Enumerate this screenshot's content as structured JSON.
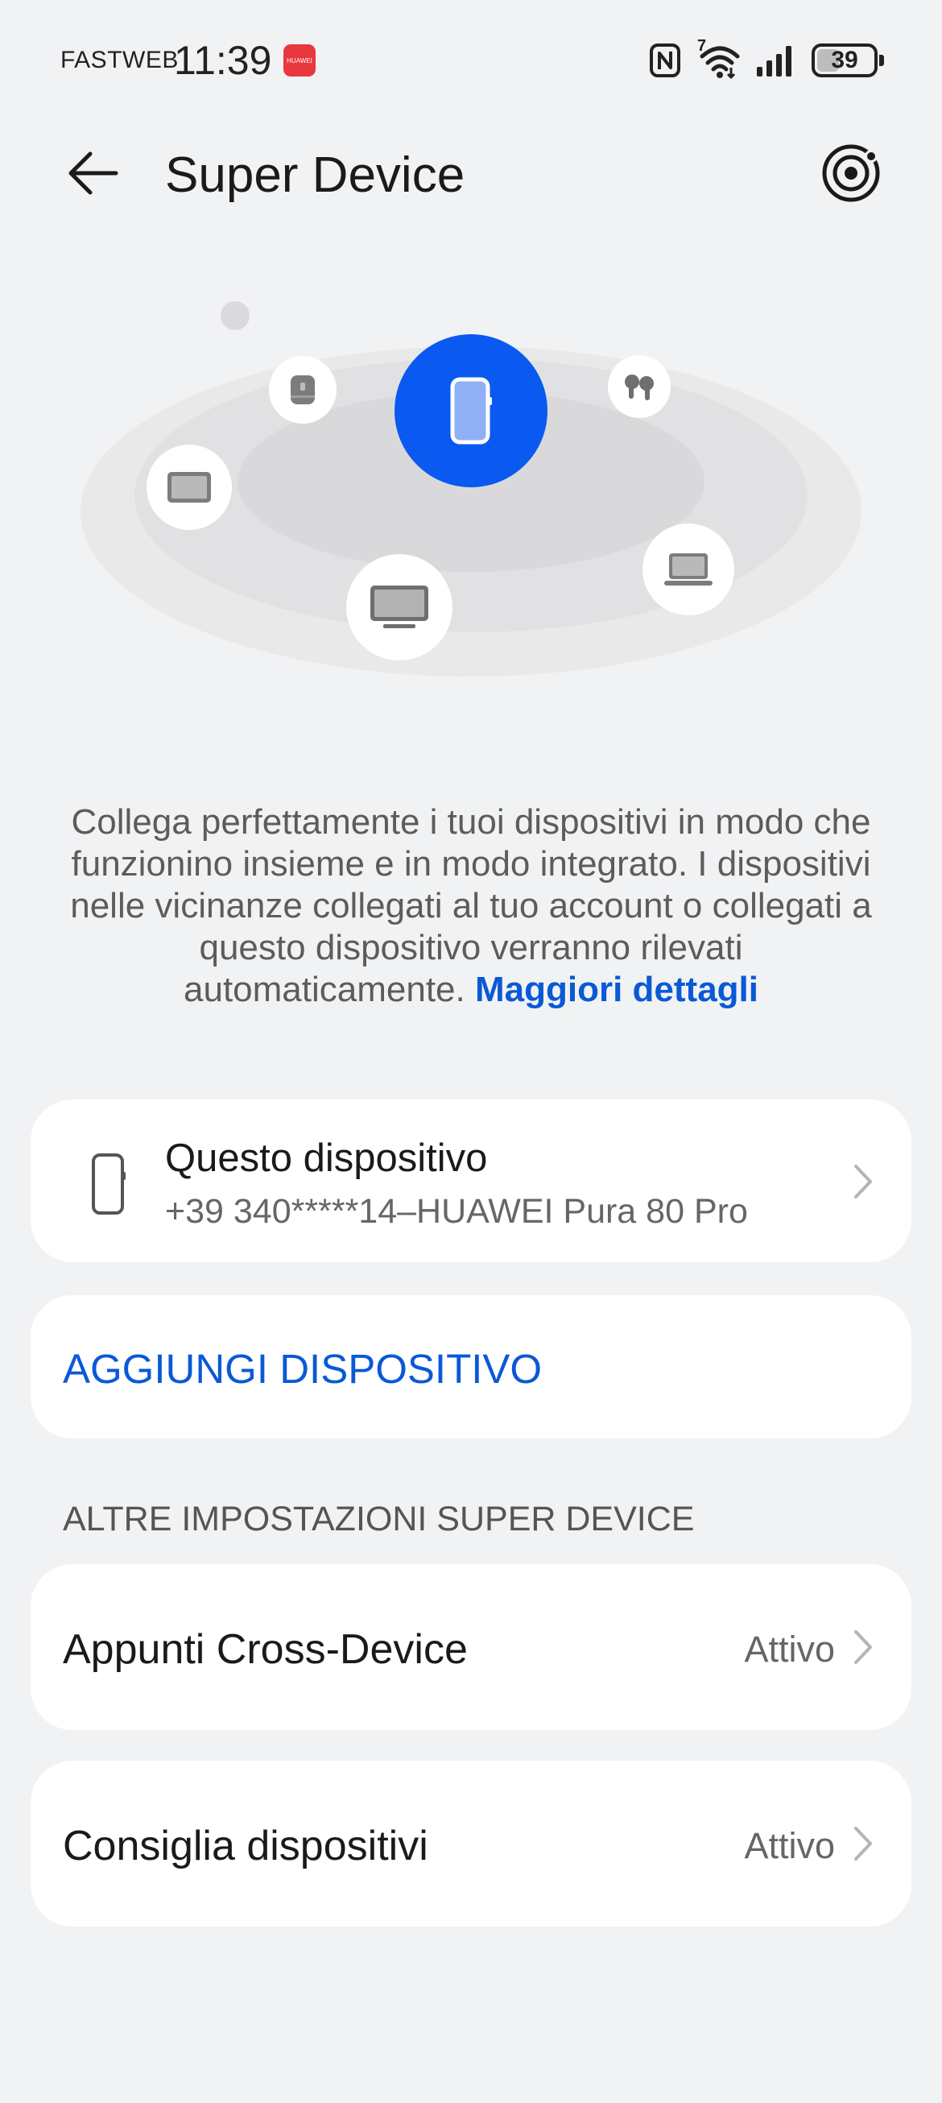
{
  "status_bar": {
    "carrier": "FASTWEB",
    "time": "11:39",
    "app_badge_text": "HUAWEI",
    "network_label": "7",
    "battery": "39",
    "battery_level": 0.39
  },
  "header": {
    "title": "Super Device",
    "back_icon": "arrow-left-icon",
    "radar_icon": "radar-scan-icon"
  },
  "radar": {
    "center_color": "#0a59f0",
    "devices": [
      "speaker",
      "tablet",
      "monitor",
      "earbuds",
      "laptop"
    ]
  },
  "description": {
    "text": "Collega perfettamente i tuoi dispositivi in modo che funzionino insieme e in modo integrato. I dispositivi nelle vicinanze collegati al tuo account o collegati a questo dispositivo verranno rilevati automaticamente.",
    "link": "Maggiori dettagli"
  },
  "this_device": {
    "title": "Questo dispositivo",
    "subtitle": "+39 340*****14–HUAWEI Pura 80 Pro"
  },
  "add_device": {
    "label": "AGGIUNGI DISPOSITIVO"
  },
  "section": {
    "label": "ALTRE IMPOSTAZIONI SUPER DEVICE"
  },
  "settings": [
    {
      "label": "Appunti Cross-Device",
      "value": "Attivo"
    },
    {
      "label": "Consiglia dispositivi",
      "value": "Attivo"
    }
  ],
  "colors": {
    "accent": "#0a59d6",
    "background": "#f1f2f4",
    "card": "#ffffff"
  }
}
